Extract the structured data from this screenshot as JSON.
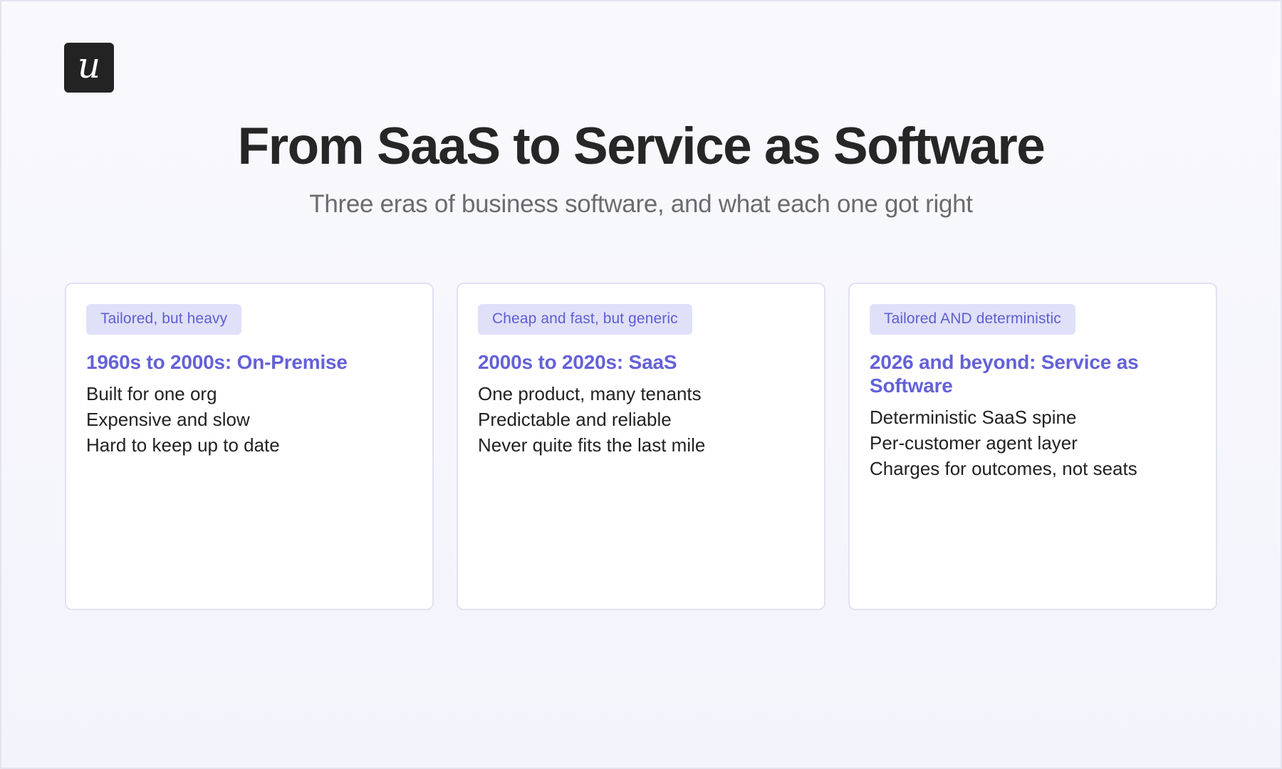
{
  "brand": {
    "logo_letter": "u"
  },
  "header": {
    "title": "From SaaS to Service as Software",
    "subtitle": "Three eras of business software, and what each one got right"
  },
  "cards": [
    {
      "badge": "Tailored, but heavy",
      "heading": "1960s to 2000s: On-Premise",
      "points": [
        "Built for one org",
        "Expensive and slow",
        "Hard to keep up to date"
      ]
    },
    {
      "badge": "Cheap and fast, but generic",
      "heading": "2000s to 2020s: SaaS",
      "points": [
        "One product, many tenants",
        "Predictable and reliable",
        "Never quite fits the last mile"
      ]
    },
    {
      "badge": "Tailored AND deterministic",
      "heading": "2026 and beyond: Service as Software",
      "points": [
        "Deterministic SaaS spine",
        "Per-customer agent layer",
        "Charges for outcomes, not seats"
      ]
    }
  ],
  "colors": {
    "accent": "#6461d8",
    "badge_bg": "#e0e0f9",
    "logo_bg": "#232323",
    "background": "#f7f7fc"
  }
}
